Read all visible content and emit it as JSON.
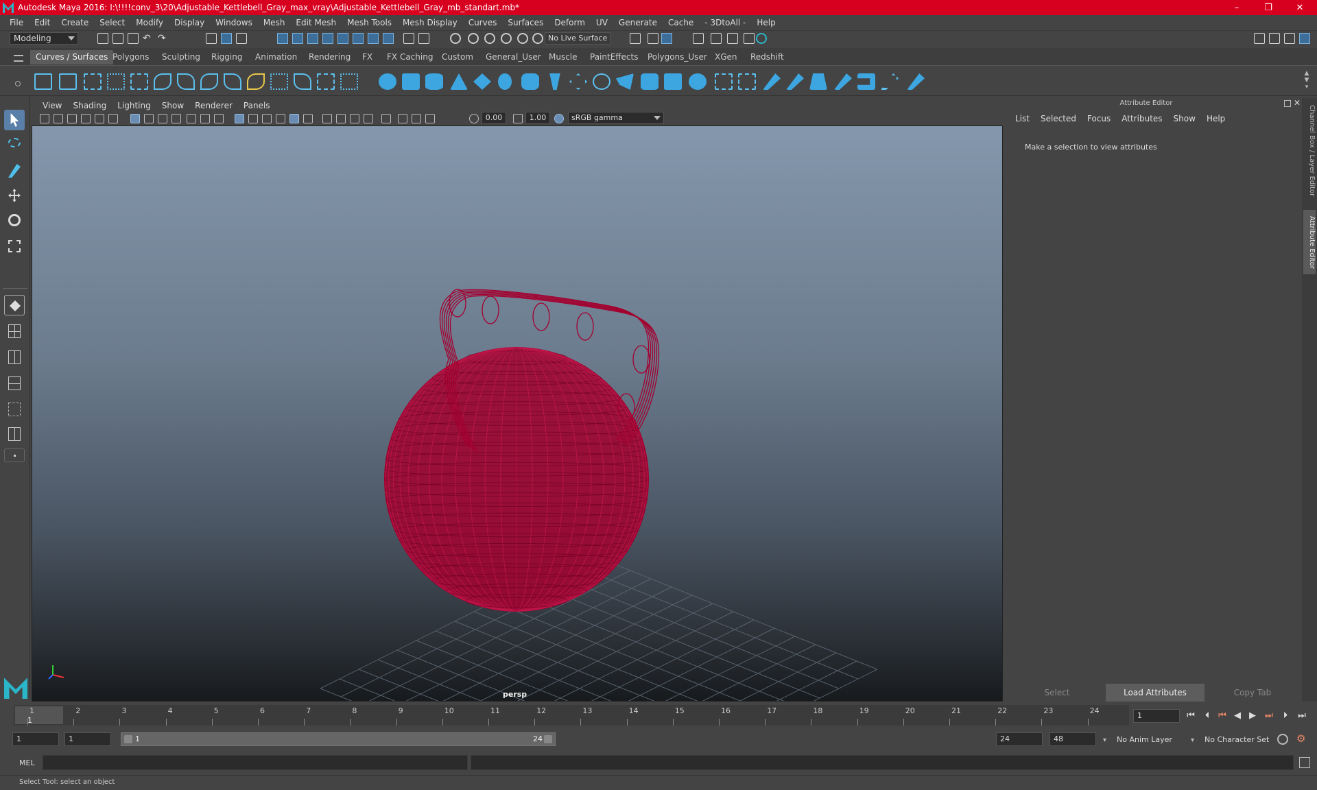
{
  "window": {
    "title": "Autodesk Maya 2016: I:\\!!!!conv_3\\20\\Adjustable_Kettlebell_Gray_max_vray\\Adjustable_Kettlebell_Gray_mb_standart.mb*",
    "minimize": "–",
    "restore": "❐",
    "close": "✕"
  },
  "menubar": [
    "File",
    "Edit",
    "Create",
    "Select",
    "Modify",
    "Display",
    "Windows",
    "Mesh",
    "Edit Mesh",
    "Mesh Tools",
    "Mesh Display",
    "Curves",
    "Surfaces",
    "Deform",
    "UV",
    "Generate",
    "Cache",
    "- 3DtoAll -",
    "Help"
  ],
  "statusline": {
    "mode": "Modeling",
    "live_surface": "No Live Surface"
  },
  "shelf": {
    "tabs": [
      "Curves / Surfaces",
      "Polygons",
      "Sculpting",
      "Rigging",
      "Animation",
      "Rendering",
      "FX",
      "FX Caching",
      "Custom",
      "General_User",
      "Muscle",
      "PaintEffects",
      "Polygons_User",
      "XGen",
      "Redshift"
    ],
    "active_tab": "Curves / Surfaces"
  },
  "viewport": {
    "menu": [
      "View",
      "Shading",
      "Lighting",
      "Show",
      "Renderer",
      "Panels"
    ],
    "exposure": "0.00",
    "gamma": "1.00",
    "color_space": "sRGB gamma",
    "camera_label": "persp",
    "wire_color": "#a3002f"
  },
  "attribute_editor": {
    "title": "Attribute Editor",
    "menu": [
      "List",
      "Selected",
      "Focus",
      "Attributes",
      "Show",
      "Help"
    ],
    "message": "Make a selection to view attributes",
    "buttons": [
      "Select",
      "Load Attributes",
      "Copy Tab"
    ]
  },
  "side_tabs": [
    "Channel Box / Layer Editor",
    "Attribute Editor"
  ],
  "timeline": {
    "ticks": [
      "1",
      "2",
      "3",
      "4",
      "5",
      "6",
      "7",
      "8",
      "9",
      "10",
      "11",
      "12",
      "13",
      "14",
      "15",
      "16",
      "17",
      "18",
      "19",
      "20",
      "21",
      "22",
      "23",
      "24"
    ],
    "current_frame": "1",
    "current_frame_field": "1"
  },
  "range": {
    "start": "1",
    "playback_start": "1",
    "slider_start": "1",
    "slider_end": "24",
    "playback_end": "24",
    "end": "48",
    "anim_layer": "No Anim Layer",
    "character_set": "No Character Set"
  },
  "cmdline": {
    "lang": "MEL"
  },
  "status": {
    "help": "Select Tool: select an object"
  }
}
